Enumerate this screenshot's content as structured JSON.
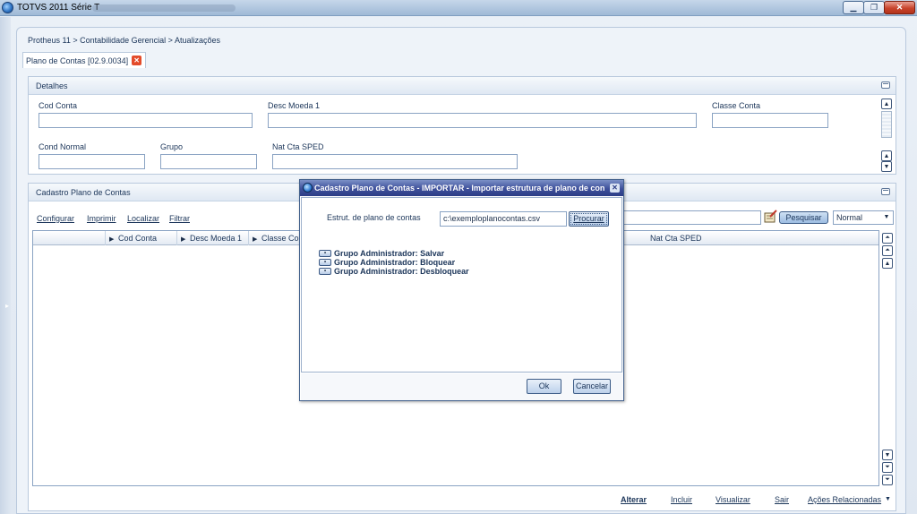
{
  "window": {
    "title": "TOTVS 2011 Série T"
  },
  "breadcrumb": "Protheus 11 > Contabilidade Gerencial > Atualizações",
  "tab": {
    "label": "Plano de Contas [02.9.0034]"
  },
  "details": {
    "header": "Detalhes",
    "fields": {
      "cod_conta": {
        "label": "Cod Conta",
        "value": ""
      },
      "desc_moeda": {
        "label": "Desc Moeda 1",
        "value": ""
      },
      "classe_conta": {
        "label": "Classe Conta",
        "value": ""
      },
      "cond_normal": {
        "label": "Cond Normal",
        "value": ""
      },
      "grupo": {
        "label": "Grupo",
        "value": ""
      },
      "nat_cta_sped": {
        "label": "Nat Cta SPED",
        "value": ""
      }
    }
  },
  "cadastro": {
    "header": "Cadastro Plano de Contas",
    "links": [
      "Configurar",
      "Imprimir",
      "Localizar",
      "Filtrar"
    ],
    "search": {
      "value": "",
      "button": "Pesquisar",
      "mode": "Normal"
    },
    "columns": [
      "Cod Conta",
      "Desc Moeda 1",
      "Classe Co",
      "Nat Cta SPED"
    ],
    "actions": [
      "Alterar",
      "Incluir",
      "Visualizar",
      "Sair",
      "Ações Relacionadas"
    ]
  },
  "dialog": {
    "title": "Cadastro Plano de Contas - IMPORTAR - Importar estrutura de plano de con",
    "file_label": "Estrut. de plano de contas",
    "file_value": "c:\\exemploplanocontas.csv",
    "browse_button": "Procurar",
    "group_items": [
      "Grupo Administrador: Salvar",
      "Grupo Administrador: Bloquear",
      "Grupo Administrador: Desbloquear"
    ],
    "ok_button": "Ok",
    "cancel_button": "Cancelar"
  }
}
